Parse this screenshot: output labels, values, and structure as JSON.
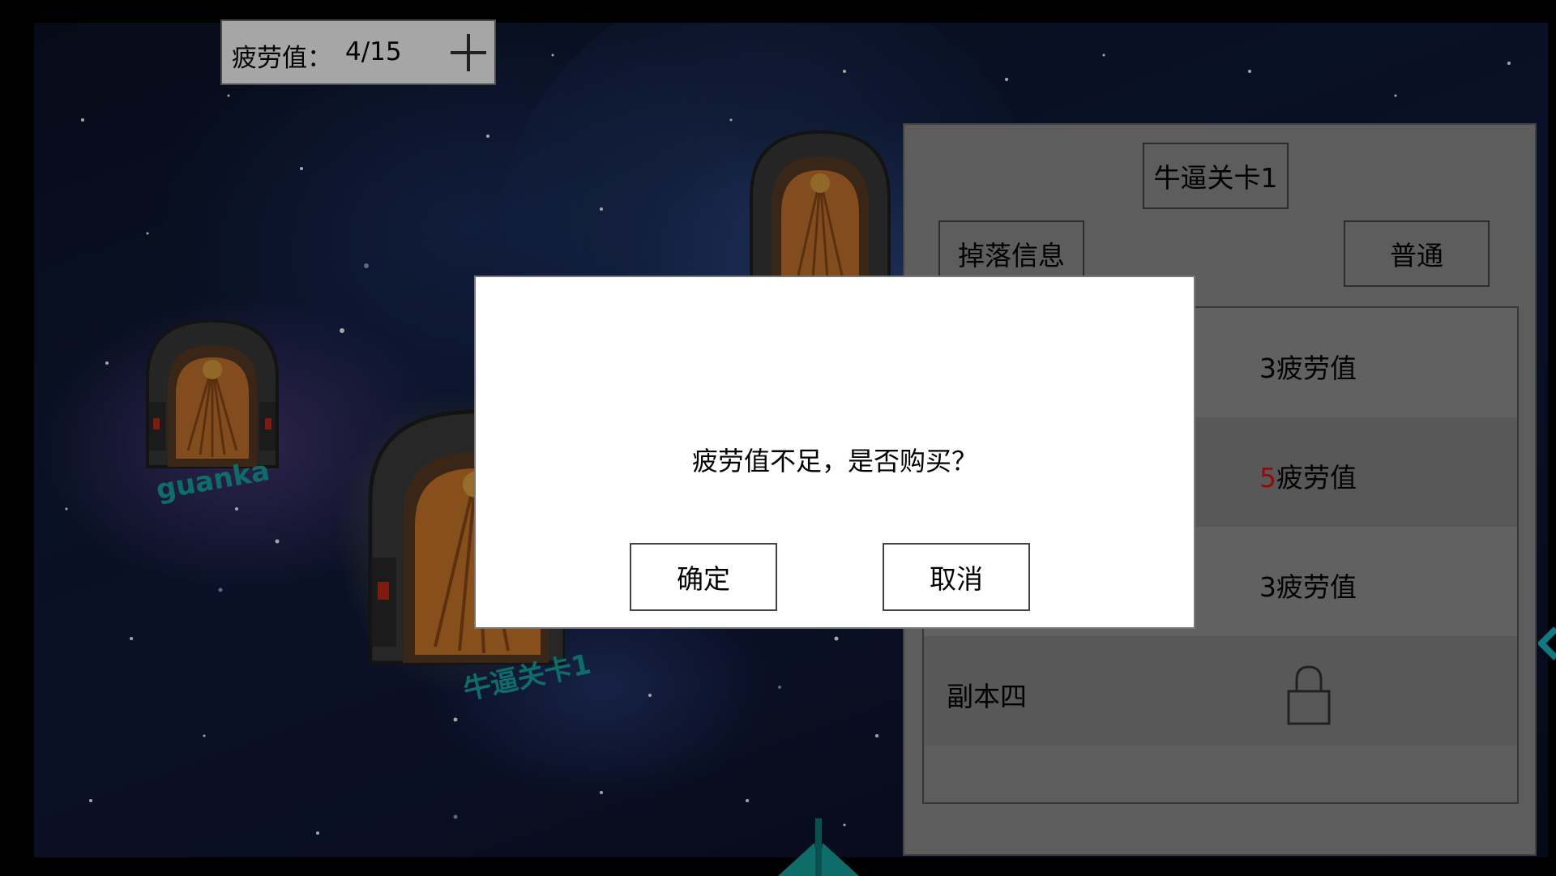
{
  "hud": {
    "fatigue_label": "疲劳值：",
    "fatigue_value": "4/15",
    "add_icon": "plus-icon"
  },
  "map": {
    "portal_labels": [
      "guanka",
      "牛逼关卡1"
    ]
  },
  "stage_panel": {
    "title": "牛逼关卡1",
    "drop_info_label": "掉落信息",
    "mode_label": "普通",
    "dungeons": [
      {
        "name": "",
        "cost_prefix": "",
        "cost_number": "3",
        "cost_unit": "疲劳值"
      },
      {
        "name": "",
        "cost_prefix": "",
        "cost_number": "5",
        "cost_unit": "疲劳值",
        "number_color": "#e01010"
      },
      {
        "name": "",
        "cost_prefix": "",
        "cost_number": "3",
        "cost_unit": "疲劳值"
      },
      {
        "name": "副本四",
        "locked": true,
        "icon": "lock-icon"
      }
    ]
  },
  "dialog": {
    "message": "疲劳值不足，是否购买？",
    "confirm_label": "确定",
    "cancel_label": "取消"
  },
  "colors": {
    "label_teal": "#16a8a0",
    "panel_gray": "#8f8f8f",
    "warning_red": "#e01010"
  }
}
